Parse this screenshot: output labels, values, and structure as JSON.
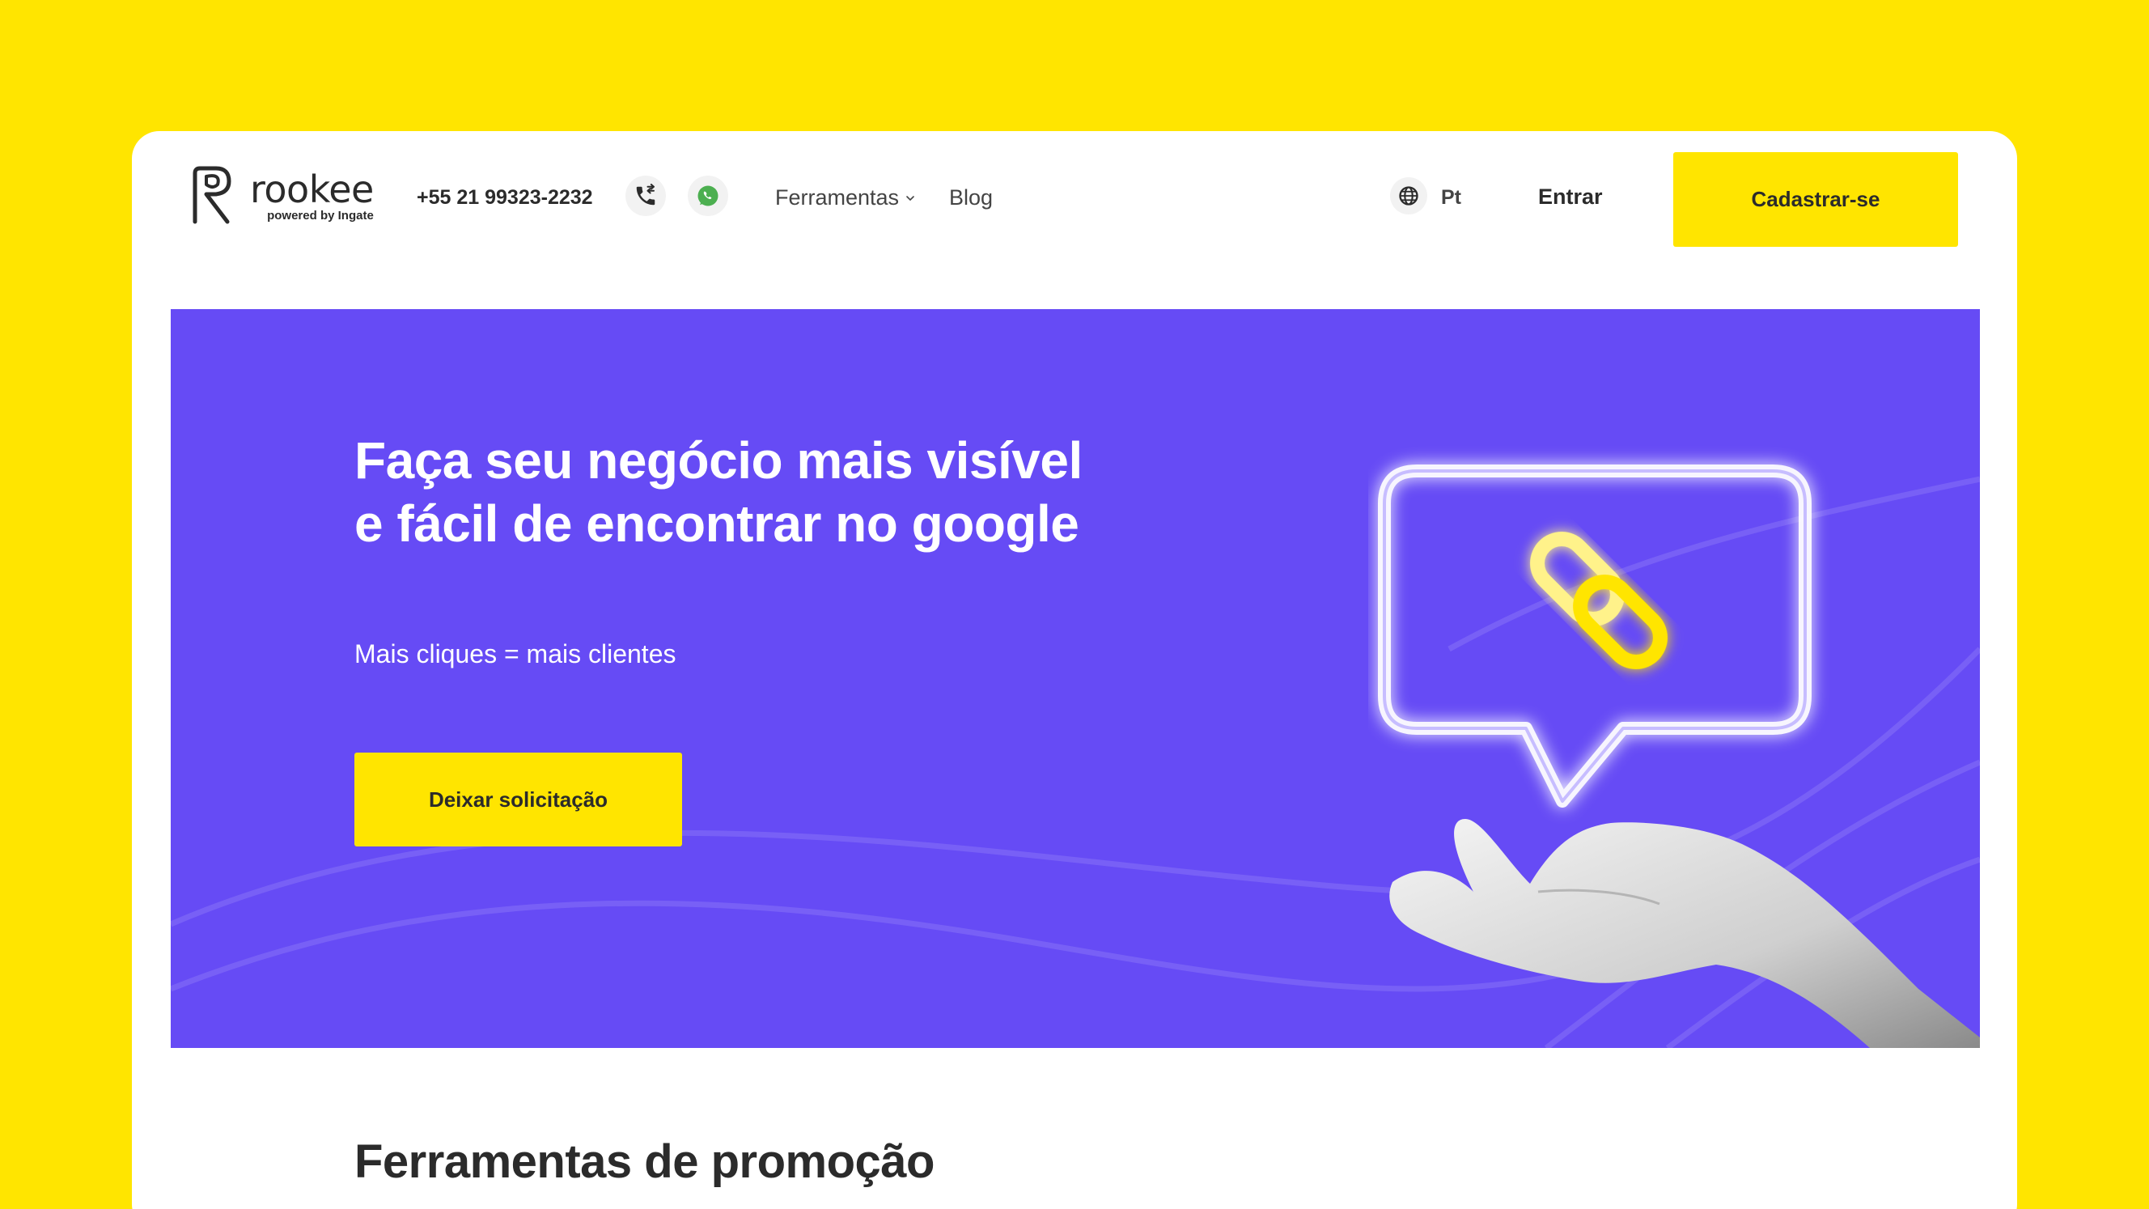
{
  "brand": {
    "name": "rookee",
    "tagline": "powered by Ingate"
  },
  "header": {
    "phone": "+55 21 99323-2232",
    "nav": {
      "tools_label": "Ferramentas",
      "blog_label": "Blog"
    },
    "language": "Pt",
    "login_label": "Entrar",
    "signup_label": "Cadastrar-se"
  },
  "hero": {
    "title": "Faça seu negócio mais visível e fácil de encontrar no google",
    "subtitle": "Mais cliques = mais clientes",
    "cta_label": "Deixar solicitação"
  },
  "section": {
    "title": "Ferramentas de promoção"
  },
  "icons": {
    "logo": "rookee-logo-icon",
    "phone": "phone-call-icon",
    "whatsapp": "whatsapp-icon",
    "dropdown": "chevron-down-icon",
    "language": "globe-icon",
    "illustration": "link-chat-bubble-hand-illustration"
  },
  "colors": {
    "background": "#FFE500",
    "accent": "#FFE500",
    "hero": "#664BF5",
    "text": "#2b2b2b",
    "whatsapp": "#4CAF50"
  }
}
